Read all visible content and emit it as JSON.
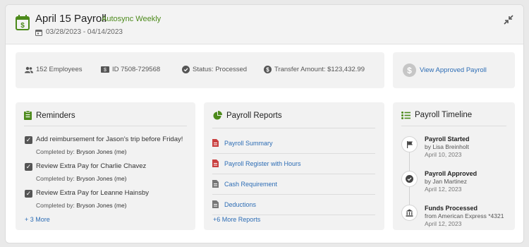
{
  "header": {
    "title": "April 15 Payroll",
    "autosync": "Autosync Weekly",
    "date_range": "03/28/2023 - 04/14/2023",
    "accent_color": "#4c8a1b"
  },
  "info": {
    "employees": "152 Employees",
    "id": "ID 7508-729568",
    "status": "Status: Processed",
    "transfer": "Transfer Amount: $123,432.99",
    "view_link": "View Approved Payroll"
  },
  "reminders": {
    "title": "Reminders",
    "completed_prefix": "Completed by:",
    "items": [
      {
        "text": "Add reimbursement for Jason’s trip before Friday!",
        "by": "Bryson Jones (me)"
      },
      {
        "text": "Review Extra Pay for Charlie Chavez",
        "by": "Bryson Jones (me)"
      },
      {
        "text": "Review Extra Pay for Leanne Hainsby",
        "by": "Bryson Jones (me)"
      }
    ],
    "more": "+ 3 More"
  },
  "reports": {
    "title": "Payroll Reports",
    "items": [
      {
        "label": "Payroll Summary",
        "icon": "pdf-icon"
      },
      {
        "label": "Payroll Register with Hours",
        "icon": "pdf-icon"
      },
      {
        "label": "Cash Requirement",
        "icon": "document-icon"
      },
      {
        "label": "Deductions",
        "icon": "document-icon"
      }
    ],
    "more": "+6 More Reports"
  },
  "timeline": {
    "title": "Payroll Timeline",
    "events": [
      {
        "title": "Payroll Started",
        "by": "by Lisa Breinholt",
        "date": "April 10, 2023",
        "icon": "flag-icon"
      },
      {
        "title": "Payroll Approved",
        "by": "by Jan Martinez",
        "date": "April 12, 2023",
        "icon": "check-icon"
      },
      {
        "title": "Funds Processed",
        "by": "from American Express *4321",
        "date": "April 12, 2023",
        "icon": "bank-icon"
      }
    ]
  }
}
